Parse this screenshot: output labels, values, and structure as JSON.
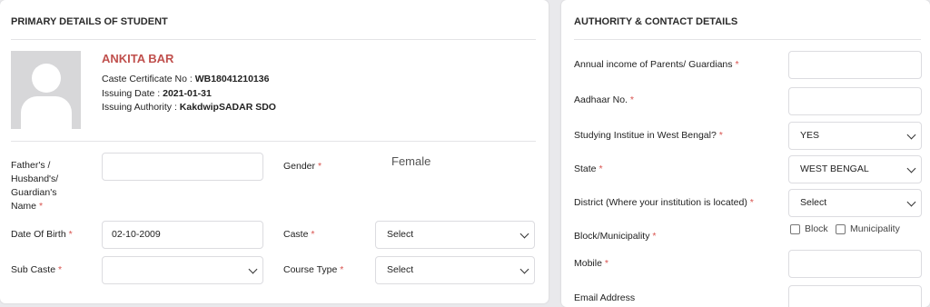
{
  "primary": {
    "title": "PRIMARY DETAILS OF STUDENT",
    "student_name": "ANKITA BAR",
    "caste_cert_label": "Caste Certificate No : ",
    "caste_cert_value": "WB18041210136",
    "issuing_date_label": "Issuing Date : ",
    "issuing_date_value": "2021-01-31",
    "issuing_authority_label": "Issuing Authority : ",
    "issuing_authority_value": "KakdwipSADAR SDO",
    "fathers_label_lines": [
      "Father's /",
      "Husband's/",
      "Guardian's",
      "Name"
    ],
    "fathers_value": "",
    "gender_label": "Gender",
    "gender_value": "Female",
    "dob_label": "Date Of Birth",
    "dob_value": "02-10-2009",
    "caste_label": "Caste",
    "caste_value": "Select",
    "subcaste_label": "Sub Caste",
    "subcaste_value": "",
    "course_type_label": "Course Type",
    "course_type_value": "Select",
    "required_mark": "*"
  },
  "authority": {
    "title": "AUTHORITY & CONTACT DETAILS",
    "income_label": "Annual income of Parents/ Guardians",
    "income_value": "",
    "aadhaar_label": "Aadhaar No.",
    "aadhaar_value": "",
    "studying_label": "Studying Institue in West Bengal?",
    "studying_value": "YES",
    "state_label": "State",
    "state_value": "WEST BENGAL",
    "district_label": "District (Where your institution is located)",
    "district_value": "Select",
    "block_label": "Block/Municipality",
    "block_option": "Block",
    "municipality_option": "Municipality",
    "mobile_label": "Mobile",
    "mobile_value": "",
    "email_label": "Email Address",
    "email_value": ""
  },
  "colors": {
    "accent_name": "#c0504d",
    "required": "#d9534f"
  },
  "icons": {
    "avatar": "user-silhouette-icon",
    "dropdown": "chevron-down-icon"
  }
}
